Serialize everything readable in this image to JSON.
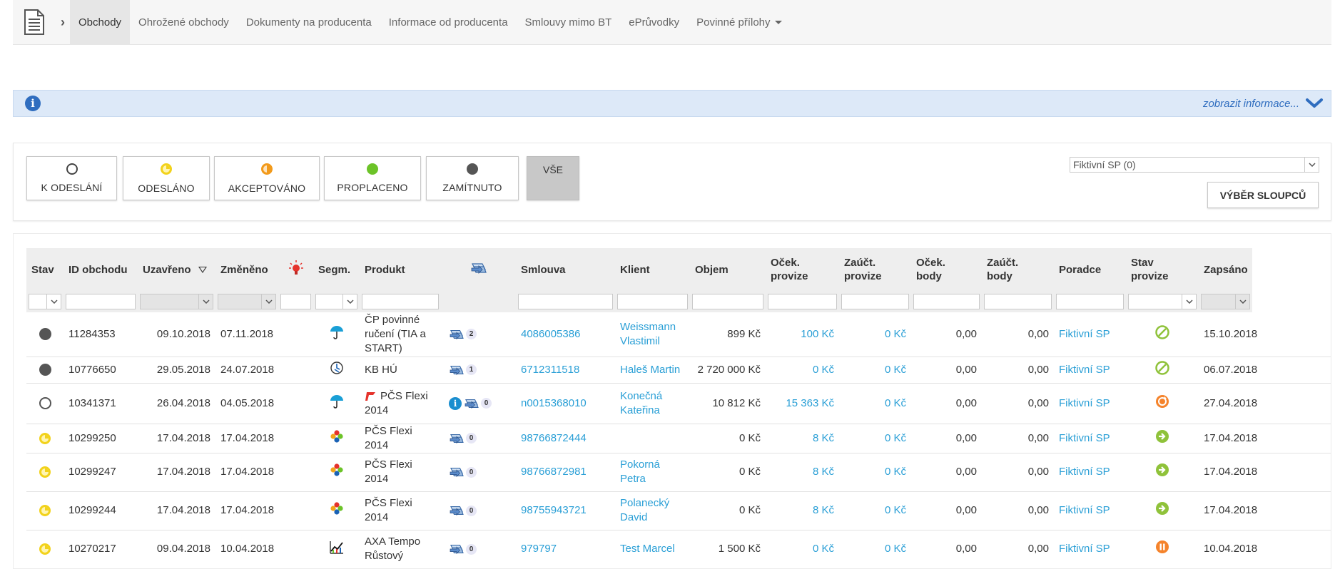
{
  "nav": {
    "tabs": [
      {
        "label": "Obchody"
      },
      {
        "label": "Ohrožené obchody"
      },
      {
        "label": "Dokumenty na producenta"
      },
      {
        "label": "Informace od producenta"
      },
      {
        "label": "Smlouvy mimo BT"
      },
      {
        "label": "ePrůvodky"
      },
      {
        "label": "Povinné přílohy"
      }
    ]
  },
  "info": {
    "toggle_label": "zobrazit informace..."
  },
  "filters": {
    "buttons": [
      {
        "label": "K ODESLÁNÍ",
        "color": "#ffffff"
      },
      {
        "label": "ODESLÁNO",
        "color": "#f2d21b"
      },
      {
        "label": "AKCEPTOVÁNO",
        "color": "#f29a1b"
      },
      {
        "label": "PROPLACENO",
        "color": "#6cc328"
      },
      {
        "label": "ZAMÍTNUTO",
        "color": "#555555"
      },
      {
        "label": "VŠE"
      }
    ],
    "advisor_select": "Fiktivní SP (0)",
    "columns_button": "VÝBĚR SLOUPCŮ"
  },
  "table": {
    "headers": {
      "stav": "Stav",
      "id": "ID obchodu",
      "uzavreno": "Uzavřeno",
      "zmeneno": "Změněno",
      "segm": "Segm.",
      "produkt": "Produkt",
      "smlouva": "Smlouva",
      "klient": "Klient",
      "objem": "Objem",
      "ocek_provize_1": "Oček.",
      "ocek_provize_2": "provize",
      "zauct_provize_1": "Zaúčt.",
      "zauct_provize_2": "provize",
      "ocek_body_1": "Oček.",
      "ocek_body_2": "body",
      "zauct_body_1": "Zaúčt.",
      "zauct_body_2": "body",
      "poradce": "Poradce",
      "stav_provize_1": "Stav",
      "stav_provize_2": "provize",
      "zapsano": "Zapsáno"
    },
    "rows": [
      {
        "stav": "zamitnuto",
        "id": "11284353",
        "uzavreno": "09.10.2018",
        "zmeneno": "07.11.2018",
        "segm": "umbrella",
        "produkt": "ČP povinné ručení (TIA a START)",
        "docs": "2",
        "smlouva": "4086005386",
        "klient": "Weissmann Vlastimil",
        "objem": "899 Kč",
        "ocek_provize": "100 Kč",
        "zauct_provize": "0 Kč",
        "ocek_body": "0,00",
        "zauct_body": "0,00",
        "poradce": "Fiktivní SP",
        "stav_provize": "cancelled",
        "zapsano": "15.10.2018"
      },
      {
        "stav": "zamitnuto",
        "id": "10776650",
        "uzavreno": "29.05.2018",
        "zmeneno": "24.07.2018",
        "segm": "clock",
        "produkt": "KB HÚ",
        "docs": "1",
        "smlouva": "6712311518",
        "klient": "Haleš Martin",
        "objem": "2 720 000 Kč",
        "ocek_provize": "0 Kč",
        "zauct_provize": "0 Kč",
        "ocek_body": "0,00",
        "zauct_body": "0,00",
        "poradce": "Fiktivní SP",
        "stav_provize": "cancelled",
        "zapsano": "06.07.2018"
      },
      {
        "stav": "k_odeslani",
        "id": "10341371",
        "uzavreno": "26.04.2018",
        "zmeneno": "04.05.2018",
        "segm": "umbrella",
        "produkt": "PČS Flexi 2014",
        "flag": true,
        "info": true,
        "docs": "0",
        "smlouva": "n0015368010",
        "klient": "Konečná Kateřina",
        "objem": "10 812 Kč",
        "ocek_provize": "15 363 Kč",
        "zauct_provize": "0 Kč",
        "ocek_body": "0,00",
        "zauct_body": "0,00",
        "poradce": "Fiktivní SP",
        "stav_provize": "refresh",
        "zapsano": "27.04.2018"
      },
      {
        "stav": "odeslano",
        "id": "10299250",
        "uzavreno": "17.04.2018",
        "zmeneno": "17.04.2018",
        "segm": "clover",
        "produkt": "PČS Flexi 2014",
        "docs": "0",
        "smlouva": "98766872444",
        "klient": "",
        "objem": "0 Kč",
        "ocek_provize": "8 Kč",
        "zauct_provize": "0 Kč",
        "ocek_body": "0,00",
        "zauct_body": "0,00",
        "poradce": "Fiktivní SP",
        "stav_provize": "forward",
        "zapsano": "17.04.2018"
      },
      {
        "stav": "odeslano",
        "id": "10299247",
        "uzavreno": "17.04.2018",
        "zmeneno": "17.04.2018",
        "segm": "clover",
        "produkt": "PČS Flexi 2014",
        "docs": "0",
        "smlouva": "98766872981",
        "klient": "Pokorná Petra",
        "objem": "0 Kč",
        "ocek_provize": "8 Kč",
        "zauct_provize": "0 Kč",
        "ocek_body": "0,00",
        "zauct_body": "0,00",
        "poradce": "Fiktivní SP",
        "stav_provize": "forward",
        "zapsano": "17.04.2018"
      },
      {
        "stav": "odeslano",
        "id": "10299244",
        "uzavreno": "17.04.2018",
        "zmeneno": "17.04.2018",
        "segm": "clover",
        "produkt": "PČS Flexi 2014",
        "docs": "0",
        "smlouva": "98755943721",
        "klient": "Polanecký David",
        "objem": "0 Kč",
        "ocek_provize": "8 Kč",
        "zauct_provize": "0 Kč",
        "ocek_body": "0,00",
        "zauct_body": "0,00",
        "poradce": "Fiktivní SP",
        "stav_provize": "forward",
        "zapsano": "17.04.2018"
      },
      {
        "stav": "odeslano",
        "id": "10270217",
        "uzavreno": "09.04.2018",
        "zmeneno": "10.04.2018",
        "segm": "chart",
        "produkt": "AXA Tempo Růstový",
        "docs": "0",
        "smlouva": "979797",
        "klient": "Test Marcel",
        "objem": "1 500 Kč",
        "ocek_provize": "0 Kč",
        "zauct_provize": "0 Kč",
        "ocek_body": "0,00",
        "zauct_body": "0,00",
        "poradce": "Fiktivní SP",
        "stav_provize": "pause",
        "zapsano": "10.04.2018"
      }
    ]
  },
  "colors": {
    "link": "#2a9fd6",
    "info_bg": "#dde9f8",
    "info_accent": "#2f6dbf"
  }
}
